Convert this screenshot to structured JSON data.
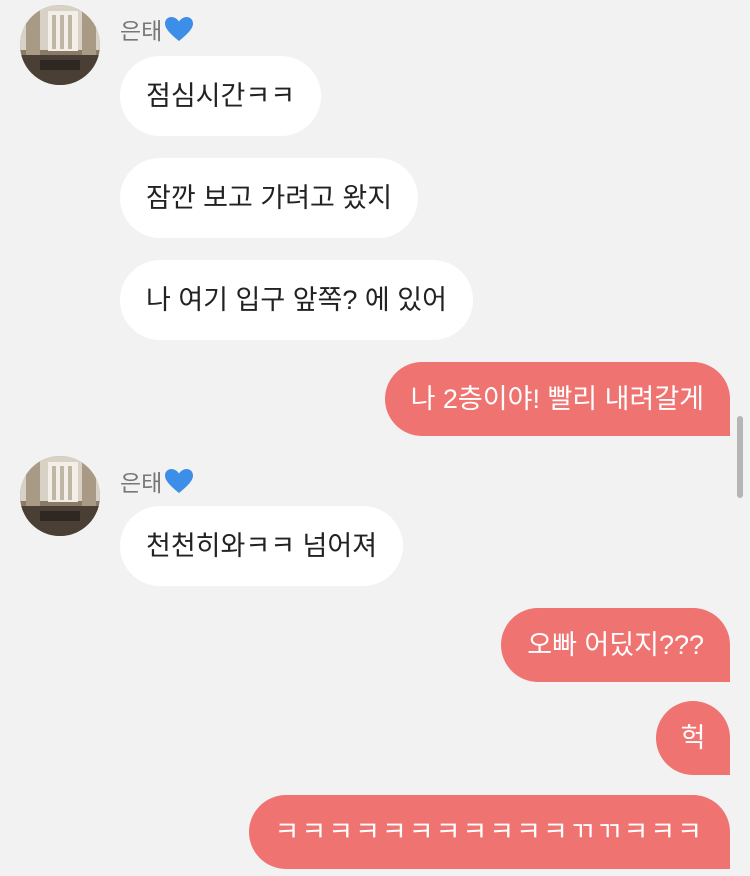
{
  "sender": {
    "name": "은태",
    "heart_icon": "blue-heart-icon",
    "heart_color": "#3d8ee8"
  },
  "colors": {
    "background": "#f2f2f2",
    "incoming_bubble": "#ffffff",
    "outgoing_bubble": "#ef7370"
  },
  "messages": {
    "m1": "점심시간ㅋㅋ",
    "m2": "잠깐 보고 가려고 왔지",
    "m3": "나 여기 입구 앞쪽? 에 있어",
    "m4": "나 2층이야! 빨리 내려갈게",
    "m5": "천천히와ㅋㅋ 넘어져",
    "m6": "오빠 어딨지???",
    "m7": "헉",
    "m8": "ㅋㅋㅋㅋㅋㅋㅋㅋㅋㅋㅋㄲㄲㅋㅋㅋ"
  }
}
